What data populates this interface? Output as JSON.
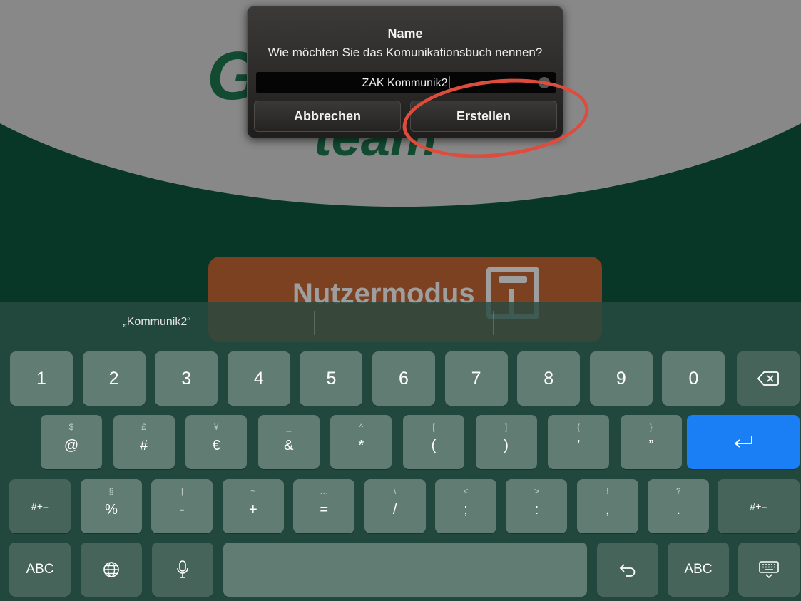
{
  "background": {
    "logo_text_line1": "G",
    "logo_text_line2": "team",
    "mode_button_label": "Nutzermodus"
  },
  "alert": {
    "title": "Name",
    "message": "Wie möchten Sie das Komunikationsbuch nennen?",
    "input_value": "ZAK Kommunik2",
    "cancel_label": "Abbrechen",
    "confirm_label": "Erstellen"
  },
  "keyboard": {
    "suggestions": [
      "„Kommunik2“",
      "",
      ""
    ],
    "row1": [
      {
        "main": "1",
        "name": "key-1"
      },
      {
        "main": "2",
        "name": "key-2"
      },
      {
        "main": "3",
        "name": "key-3"
      },
      {
        "main": "4",
        "name": "key-4"
      },
      {
        "main": "5",
        "name": "key-5"
      },
      {
        "main": "6",
        "name": "key-6"
      },
      {
        "main": "7",
        "name": "key-7"
      },
      {
        "main": "8",
        "name": "key-8"
      },
      {
        "main": "9",
        "name": "key-9"
      },
      {
        "main": "0",
        "name": "key-0"
      }
    ],
    "row2": [
      {
        "top": "$",
        "main": "@",
        "name": "key-at"
      },
      {
        "top": "£",
        "main": "#",
        "name": "key-hash"
      },
      {
        "top": "¥",
        "main": "€",
        "name": "key-euro"
      },
      {
        "top": "_",
        "main": "&",
        "name": "key-ampersand"
      },
      {
        "top": "^",
        "main": "*",
        "name": "key-asterisk"
      },
      {
        "top": "[",
        "main": "(",
        "name": "key-paren-open"
      },
      {
        "top": "]",
        "main": ")",
        "name": "key-paren-close"
      },
      {
        "top": "{",
        "main": "’",
        "name": "key-apostrophe"
      },
      {
        "top": "}",
        "main": "”",
        "name": "key-quote"
      }
    ],
    "row3": [
      {
        "top": "§",
        "main": "%",
        "name": "key-percent"
      },
      {
        "top": "|",
        "main": "-",
        "name": "key-minus"
      },
      {
        "top": "~",
        "main": "+",
        "name": "key-plus"
      },
      {
        "top": "…",
        "main": "=",
        "name": "key-equals"
      },
      {
        "top": "\\",
        "main": "/",
        "name": "key-slash"
      },
      {
        "top": "<",
        "main": ";",
        "name": "key-semicolon"
      },
      {
        "top": ">",
        "main": ":",
        "name": "key-colon"
      },
      {
        "top": "!",
        "main": ",",
        "name": "key-comma"
      },
      {
        "top": "?",
        "main": ".",
        "name": "key-period"
      }
    ],
    "shift_label": "#+=",
    "abc_label": "ABC",
    "accent_color": "#1a7ef5",
    "icons": {
      "delete": "backspace-icon",
      "return": "return-icon",
      "globe": "globe-icon",
      "mic": "microphone-icon",
      "undo": "undo-icon",
      "dismiss": "keyboard-dismiss-icon"
    }
  }
}
